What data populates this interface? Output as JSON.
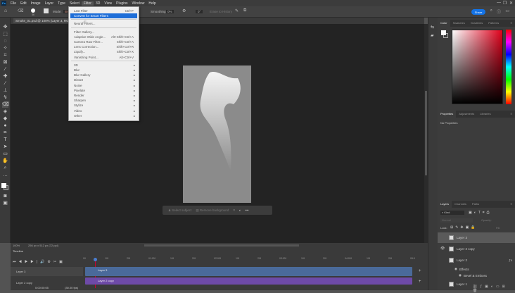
{
  "app": {
    "logo": "Ps"
  },
  "menubar": [
    "File",
    "Edit",
    "Image",
    "Layer",
    "Type",
    "Select",
    "Filter",
    "3D",
    "View",
    "Plugins",
    "Window",
    "Help"
  ],
  "window_controls": [
    "—",
    "❐",
    "✕"
  ],
  "options": {
    "brush_size": "36",
    "mode_label": "Mode:",
    "mode_value": "Brush",
    "smoothing_label": "Smoothing:",
    "smoothing_value": "0%",
    "angle_value": "0°",
    "erase_history": "Erase to History",
    "share": "Share"
  },
  "document_tab": "Smoke_01.psd @ 100% (Layer 3, RGB/8)",
  "filter_menu": {
    "groups": [
      [
        {
          "label": "Last Filter",
          "shortcut": "Ctrl+F"
        },
        {
          "label": "Convert for Smart Filters",
          "shortcut": "",
          "highlighted": true
        }
      ],
      [
        {
          "label": "Neural Filters...",
          "shortcut": ""
        }
      ],
      [
        {
          "label": "Filter Gallery...",
          "shortcut": ""
        },
        {
          "label": "Adaptive Wide Angle...",
          "shortcut": "Alt+Shift+Ctrl+A"
        },
        {
          "label": "Camera Raw Filter...",
          "shortcut": "Shift+Ctrl+A"
        },
        {
          "label": "Lens Correction...",
          "shortcut": "Shift+Ctrl+R"
        },
        {
          "label": "Liquify...",
          "shortcut": "Shift+Ctrl+X"
        },
        {
          "label": "Vanishing Point...",
          "shortcut": "Alt+Ctrl+V"
        }
      ],
      [
        {
          "label": "3D",
          "sub": true
        },
        {
          "label": "Blur",
          "sub": true
        },
        {
          "label": "Blur Gallery",
          "sub": true
        },
        {
          "label": "Distort",
          "sub": true
        },
        {
          "label": "Noise",
          "sub": true
        },
        {
          "label": "Pixelate",
          "sub": true
        },
        {
          "label": "Render",
          "sub": true
        },
        {
          "label": "Sharpen",
          "sub": true
        },
        {
          "label": "Stylize",
          "sub": true
        },
        {
          "label": "Video",
          "sub": true
        },
        {
          "label": "Other",
          "sub": true
        }
      ]
    ]
  },
  "context_bar": {
    "select_subject": "Select subject",
    "remove_background": "Remove background"
  },
  "color_panel": {
    "tabs": [
      "Color",
      "Swatches",
      "Gradients",
      "Patterns"
    ]
  },
  "properties_panel": {
    "tabs": [
      "Properties",
      "Adjustments",
      "Libraries"
    ],
    "empty": "No Properties"
  },
  "layers_panel": {
    "tabs": [
      "Layers",
      "Channels",
      "Paths"
    ],
    "kind": "Kind",
    "blend": "Normal",
    "opacity_label": "Opacity:",
    "lock_label": "Lock:",
    "fill_label": "Fill:",
    "layers": [
      {
        "name": "Layer 3",
        "selected": true,
        "visible": false
      },
      {
        "name": "Layer 2 copy",
        "visible": true
      },
      {
        "name": "Layer 2",
        "visible": false,
        "fx": true
      },
      {
        "name": "Effects",
        "effect": true
      },
      {
        "name": "Bevel & Emboss",
        "effect": true
      },
      {
        "name": "Layer 1",
        "visible": false
      }
    ]
  },
  "status": {
    "zoom": "100%",
    "size": "256 px x 512 px (72 ppi)"
  },
  "timeline": {
    "title": "Timeline",
    "timecode": "0:00:00:05",
    "fps": "(30.00 fps)",
    "ruler": [
      "00",
      "10f",
      "20f",
      "01:00f",
      "10f",
      "20f",
      "02:00f",
      "10f",
      "20f",
      "03:00f",
      "10f",
      "20f",
      "04:00f",
      "10f",
      "20f",
      "05:0"
    ],
    "tracks": [
      {
        "name": "Layer 3",
        "color": "#4a6a9a"
      },
      {
        "name": "Layer 2 copy",
        "color": "#6e4aa8"
      }
    ]
  },
  "colors": {
    "accent": "#1473e6",
    "highlight": "#1e6ed8"
  }
}
